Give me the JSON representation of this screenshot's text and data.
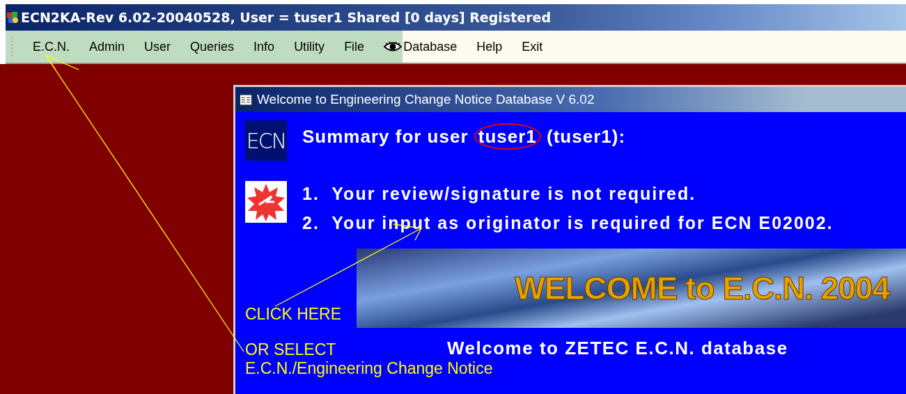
{
  "window": {
    "title": "ECN2KA-Rev 6.02-20040528, User = tuser1 Shared [0 days] Registered"
  },
  "menu": [
    {
      "label": "E.C.N.",
      "icon": false
    },
    {
      "label": "Admin",
      "icon": false
    },
    {
      "label": "User",
      "icon": false
    },
    {
      "label": "Queries",
      "icon": false
    },
    {
      "label": "Info",
      "icon": false
    },
    {
      "label": "Utility",
      "icon": false
    },
    {
      "label": "File",
      "icon": false
    },
    {
      "label": "Database",
      "icon": true
    },
    {
      "label": "Help",
      "icon": false
    },
    {
      "label": "Exit",
      "icon": false
    }
  ],
  "dialog": {
    "title": "Welcome to Engineering Change Notice Database V 6.02",
    "logo": "ECN",
    "summary": {
      "prefix": "Summary for user",
      "user": "tuser1",
      "suffix": "(tuser1):"
    },
    "items": [
      "1.  Your review/signature is not required.",
      "2.  Your input as originator is required for ECN E02002."
    ],
    "banner": "WELCOME to E.C.N. 2004",
    "click_here": "CLICK HERE",
    "or_select": "OR SELECT",
    "menu_path": "E.C.N./Engineering Change Notice",
    "welcome": "Welcome to ZETEC E.C.N. database"
  }
}
